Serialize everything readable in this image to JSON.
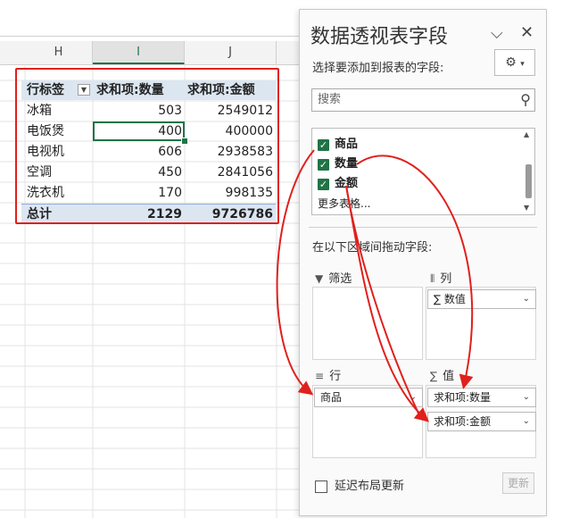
{
  "columns": [
    "H",
    "I",
    "J"
  ],
  "pivot": {
    "header": {
      "row_label": "行标签",
      "qty": "求和项:数量",
      "amount": "求和项:金额"
    },
    "rows": [
      {
        "label": "冰箱",
        "qty": "503",
        "amount": "2549012"
      },
      {
        "label": "电饭煲",
        "qty": "400",
        "amount": "400000"
      },
      {
        "label": "电视机",
        "qty": "606",
        "amount": "2938583"
      },
      {
        "label": "空调",
        "qty": "450",
        "amount": "2841056"
      },
      {
        "label": "洗衣机",
        "qty": "170",
        "amount": "998135"
      }
    ],
    "total": {
      "label": "总计",
      "qty": "2129",
      "amount": "9726786"
    }
  },
  "pane": {
    "title": "数据透视表字段",
    "subtitle": "选择要添加到报表的字段:",
    "search_placeholder": "搜索",
    "fields": [
      {
        "name": "商品",
        "checked": true
      },
      {
        "name": "数量",
        "checked": true
      },
      {
        "name": "金额",
        "checked": true
      }
    ],
    "more_tables": "更多表格...",
    "drag_hint": "在以下区域间拖动字段:",
    "areas": {
      "filter": "筛选",
      "columns": "列",
      "rows": "行",
      "values": "值"
    },
    "chips": {
      "columns": "∑ 数值",
      "rows": "商品",
      "values_qty": "求和项:数量",
      "values_amount": "求和项:金额"
    },
    "defer_label": "延迟布局更新",
    "update_label": "更新"
  },
  "accent": "#217346",
  "highlight_color": "#e0201c"
}
